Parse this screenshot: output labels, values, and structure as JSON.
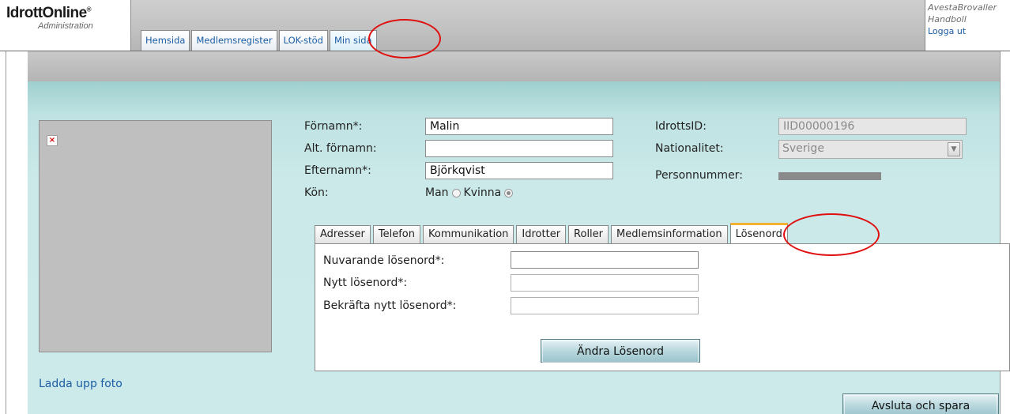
{
  "header": {
    "logo_main": "IdrottOnline",
    "logo_mark": "®",
    "logo_sub": "Administration",
    "tabs": [
      {
        "label": "Hemsida"
      },
      {
        "label": "Medlemsregister"
      },
      {
        "label": "LOK-stöd"
      },
      {
        "label": "Min sida"
      }
    ],
    "club_line1": "AvestaBrovaller",
    "club_line2": "Handboll",
    "logout": "Logga ut"
  },
  "photo": {
    "broken_icon": "×",
    "upload_link": "Ladda upp foto"
  },
  "person": {
    "first_name_label": "Förnamn*:",
    "first_name_value": "Malin",
    "alt_first_name_label": "Alt. förnamn:",
    "alt_first_name_value": "",
    "last_name_label": "Efternamn*:",
    "last_name_value": "Björkqvist",
    "gender_label": "Kön:",
    "gender_man": "Man",
    "gender_woman": "Kvinna",
    "gender_selected": "Kvinna",
    "idrotts_id_label": "IdrottsID:",
    "idrotts_id_value": "IID00000196",
    "nationality_label": "Nationalitet:",
    "nationality_value": "Sverige",
    "personnummer_label": "Personnummer:"
  },
  "subtabs": [
    {
      "label": "Adresser"
    },
    {
      "label": "Telefon"
    },
    {
      "label": "Kommunikation"
    },
    {
      "label": "Idrotter"
    },
    {
      "label": "Roller"
    },
    {
      "label": "Medlemsinformation"
    },
    {
      "label": "Lösenord"
    }
  ],
  "password": {
    "current_label": "Nuvarande lösenord*:",
    "new_label": "Nytt lösenord*:",
    "confirm_label": "Bekräfta nytt lösenord*:",
    "change_button": "Ändra Lösenord"
  },
  "footer": {
    "save_button": "Avsluta och spara"
  },
  "colors": {
    "annotation": "#e01010",
    "link": "#1c5da3",
    "active_tab_accent": "#f2b233"
  }
}
